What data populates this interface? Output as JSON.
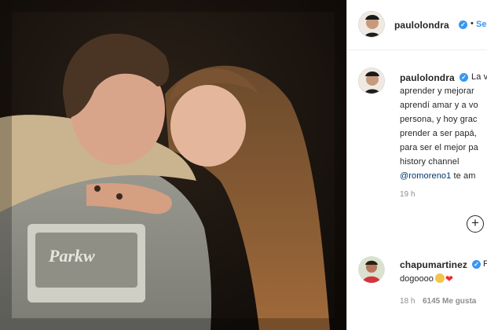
{
  "post": {
    "author": "paulolondra",
    "follow_label": "Se",
    "dot": "•"
  },
  "caption": {
    "author": "paulolondra",
    "lines": [
      "La v",
      "aprender y mejorar",
      "aprendí amar y a vo",
      "persona, y hoy grac",
      "prender a ser papá,",
      "para ser el mejor pa",
      "history channel"
    ],
    "mention": "@romoreno1",
    "mention_tail": "te am",
    "time": "19 h"
  },
  "comment": {
    "author": "chapumartinez",
    "author_tail": "F",
    "text": "dogoooo",
    "time": "18 h",
    "likes": "6145 Me gusta"
  },
  "icons": {
    "verified": "verified-badge-icon",
    "add": "plus-circle-icon",
    "heart": "red-heart-emoji-icon",
    "face": "emoji-face-icon"
  },
  "colors": {
    "verified": "#3897f0",
    "link": "#00376b",
    "follow": "#3897f0",
    "muted": "#8e8e8e"
  }
}
